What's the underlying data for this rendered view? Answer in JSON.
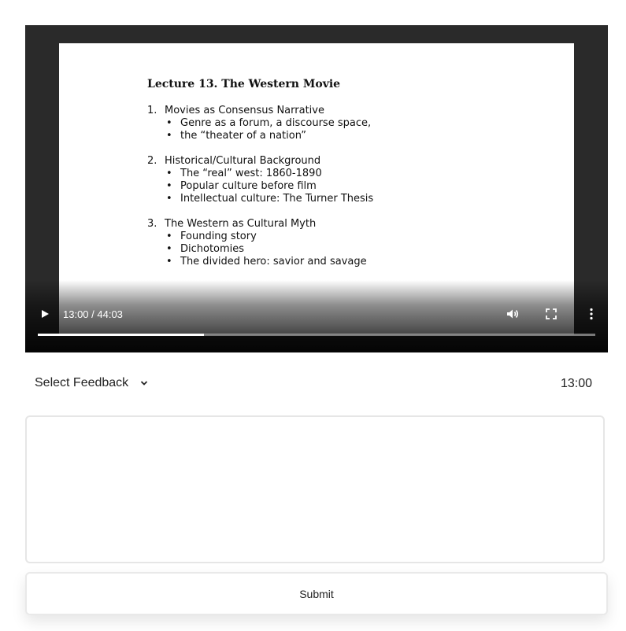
{
  "video": {
    "slide": {
      "title": "Lecture 13. The Western Movie",
      "sections": [
        {
          "num": "1.",
          "heading": "Movies as Consensus Narrative",
          "bullets": [
            "Genre as a forum, a discourse space,",
            "the “theater of a nation”"
          ]
        },
        {
          "num": "2.",
          "heading": "Historical/Cultural  Background",
          "bullets": [
            "The “real” west:  1860-1890",
            "Popular culture before film",
            "Intellectual culture: The Turner Thesis"
          ]
        },
        {
          "num": "3.",
          "heading": "The Western as Cultural Myth",
          "bullets": [
            "Founding story",
            "Dichotomies",
            "The divided hero: savior and savage"
          ]
        }
      ]
    },
    "time_display": "13:00 / 44:03",
    "progress_fraction": 0.298,
    "icons": {
      "play": "play-icon",
      "volume": "volume-icon",
      "fullscreen": "fullscreen-icon",
      "more": "more-options-icon"
    }
  },
  "feedback": {
    "select_label": "Select Feedback",
    "timestamp": "13:00",
    "textarea_value": "",
    "textarea_placeholder": ""
  },
  "submit_label": "Submit"
}
